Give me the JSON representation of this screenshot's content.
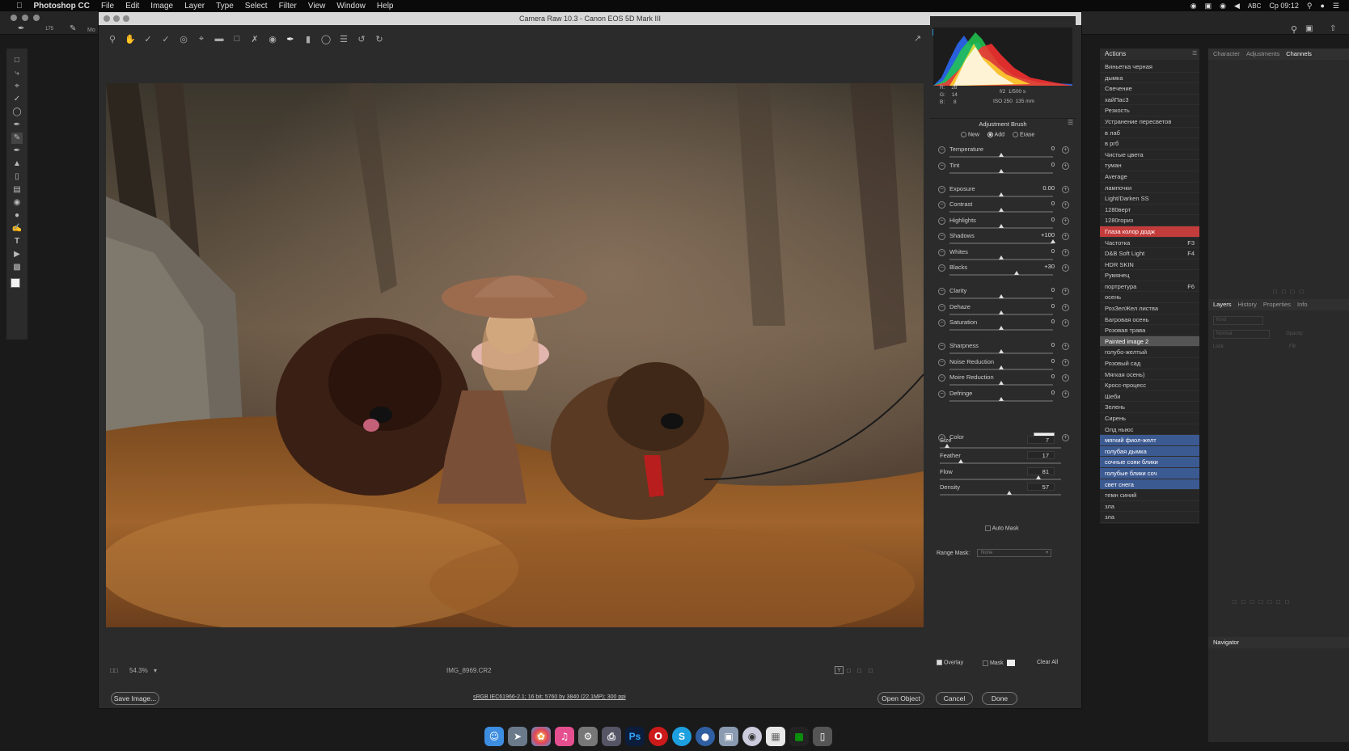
{
  "menubar": {
    "app_name": "Photoshop CC",
    "items": [
      "File",
      "Edit",
      "Image",
      "Layer",
      "Type",
      "Select",
      "Filter",
      "View",
      "Window",
      "Help"
    ],
    "input_source": "ABC",
    "clock": "Ср 09:12"
  },
  "options_bar": {
    "brush_size": "175",
    "mode_label": "Mo"
  },
  "dialog": {
    "title": "Camera Raw 10.3  -  Canon EOS 5D Mark III",
    "zoom": "54.3%",
    "filename": "IMG_8969.CR2",
    "workflow_link": "sRGB IEC61966-2.1; 16 bit; 5760 by 3840 (22.1MP); 300 ppi",
    "buttons": {
      "save": "Save Image...",
      "open": "Open Object",
      "cancel": "Cancel",
      "done": "Done"
    }
  },
  "histogram_readout": {
    "r_label": "R:",
    "r_value": "28",
    "g_label": "G:",
    "g_value": "14",
    "b_label": "B:",
    "b_value": "8",
    "aperture": "f/2",
    "shutter": "1/500 s",
    "iso": "ISO 250",
    "focal": "135 mm"
  },
  "adjustment_brush": {
    "title": "Adjustment Brush",
    "modes": [
      "New",
      "Add",
      "Erase"
    ],
    "selected_mode": "Add",
    "sliders": [
      {
        "name": "Temperature",
        "value": "0",
        "pos": 0.5
      },
      {
        "name": "Tint",
        "value": "0",
        "pos": 0.5
      },
      {
        "name": "Exposure",
        "value": "0.00",
        "pos": 0.5
      },
      {
        "name": "Contrast",
        "value": "0",
        "pos": 0.5
      },
      {
        "name": "Highlights",
        "value": "0",
        "pos": 0.5
      },
      {
        "name": "Shadows",
        "value": "+100",
        "pos": 1.0
      },
      {
        "name": "Whites",
        "value": "0",
        "pos": 0.5
      },
      {
        "name": "Blacks",
        "value": "+30",
        "pos": 0.65
      },
      {
        "name": "Clarity",
        "value": "0",
        "pos": 0.5
      },
      {
        "name": "Dehaze",
        "value": "0",
        "pos": 0.5
      },
      {
        "name": "Saturation",
        "value": "0",
        "pos": 0.5
      },
      {
        "name": "Sharpness",
        "value": "0",
        "pos": 0.5
      },
      {
        "name": "Noise Reduction",
        "value": "0",
        "pos": 0.5
      },
      {
        "name": "Moire Reduction",
        "value": "0",
        "pos": 0.5
      },
      {
        "name": "Defringe",
        "value": "0",
        "pos": 0.5
      }
    ],
    "color_label": "Color",
    "brush": [
      {
        "name": "Size",
        "value": "7",
        "pos": 0.06
      },
      {
        "name": "Feather",
        "value": "17",
        "pos": 0.17
      },
      {
        "name": "Flow",
        "value": "81",
        "pos": 0.81
      },
      {
        "name": "Density",
        "value": "57",
        "pos": 0.57
      }
    ],
    "auto_mask": "Auto Mask",
    "range_mask_label": "Range Mask:",
    "range_mask_value": "None",
    "overlay": "Overlay",
    "mask": "Mask",
    "clear_all": "Clear All"
  },
  "actions_panel": {
    "tab": "Actions",
    "items": [
      {
        "label": "Виньетка черная",
        "key": "",
        "style": ""
      },
      {
        "label": "дымка",
        "key": "",
        "style": ""
      },
      {
        "label": "Свечение",
        "key": "",
        "style": ""
      },
      {
        "label": "хайПас3",
        "key": "",
        "style": ""
      },
      {
        "label": "Резкость",
        "key": "",
        "style": ""
      },
      {
        "label": "Устранение пересветов",
        "key": "",
        "style": ""
      },
      {
        "label": "в лаб",
        "key": "",
        "style": ""
      },
      {
        "label": "в ргб",
        "key": "",
        "style": ""
      },
      {
        "label": "Чистые цвета",
        "key": "",
        "style": ""
      },
      {
        "label": "туман",
        "key": "",
        "style": ""
      },
      {
        "label": "Average",
        "key": "",
        "style": ""
      },
      {
        "label": "лампочки",
        "key": "",
        "style": ""
      },
      {
        "label": "Light/Darken SS",
        "key": "",
        "style": ""
      },
      {
        "label": "1280верт",
        "key": "",
        "style": ""
      },
      {
        "label": "1280гориз",
        "key": "",
        "style": ""
      },
      {
        "label": "Глаза колор додж",
        "key": "",
        "style": "red"
      },
      {
        "label": "Частотка",
        "key": "F3",
        "style": ""
      },
      {
        "label": "D&B Soft Light",
        "key": "F4",
        "style": ""
      },
      {
        "label": "HDR SKIN",
        "key": "",
        "style": ""
      },
      {
        "label": "Румянец",
        "key": "",
        "style": ""
      },
      {
        "label": "портретура",
        "key": "F6",
        "style": ""
      },
      {
        "label": "осень",
        "key": "",
        "style": ""
      },
      {
        "label": "РозЗелЖел листва",
        "key": "",
        "style": ""
      },
      {
        "label": "Багровая осень",
        "key": "",
        "style": ""
      },
      {
        "label": "Розовая трава",
        "key": "",
        "style": ""
      },
      {
        "label": "Painted image 2",
        "key": "",
        "style": "gray"
      },
      {
        "label": "голубо-желтый",
        "key": "",
        "style": ""
      },
      {
        "label": "Розовый сад",
        "key": "",
        "style": ""
      },
      {
        "label": "Мягкая осень)",
        "key": "",
        "style": ""
      },
      {
        "label": "Кросс-процесс",
        "key": "",
        "style": ""
      },
      {
        "label": "Шеби",
        "key": "",
        "style": ""
      },
      {
        "label": "Зелень",
        "key": "",
        "style": ""
      },
      {
        "label": "Сирень",
        "key": "",
        "style": ""
      },
      {
        "label": "Олд ныюс",
        "key": "",
        "style": ""
      },
      {
        "label": "мягкий фиол-желт",
        "key": "",
        "style": "blue"
      },
      {
        "label": "голубая дымка",
        "key": "",
        "style": "blue"
      },
      {
        "label": "сочные сояи блики",
        "key": "",
        "style": "blue"
      },
      {
        "label": "голубые блики соч",
        "key": "",
        "style": "blue"
      },
      {
        "label": "свет снега",
        "key": "",
        "style": "blue"
      },
      {
        "label": "темн синий",
        "key": "",
        "style": ""
      },
      {
        "label": "зла",
        "key": "",
        "style": ""
      },
      {
        "label": "зла",
        "key": "",
        "style": ""
      }
    ]
  },
  "right_column": {
    "top_tabs": [
      "Character",
      "Adjustments",
      "Channels"
    ],
    "layers_tabs": [
      "Layers",
      "History",
      "Properties",
      "Info"
    ],
    "kind_placeholder": "Kind",
    "blend_mode": "Normal",
    "opacity_label": "Opacity:",
    "lock_label": "Lock:",
    "fill_label": "Fill:",
    "navigator_tab": "Navigator"
  },
  "dock": {
    "items": [
      "finder-icon",
      "launchpad-icon",
      "photos-icon",
      "itunes-icon",
      "system-prefs-icon",
      "printer-icon",
      "photoshop-icon",
      "opera-icon",
      "skype-icon",
      "network-icon",
      "preview-icon",
      "quicktime-icon",
      "document-icon",
      "terminal-icon",
      "trash-icon"
    ],
    "photoshop_label": "Ps",
    "skype_label": "S"
  }
}
